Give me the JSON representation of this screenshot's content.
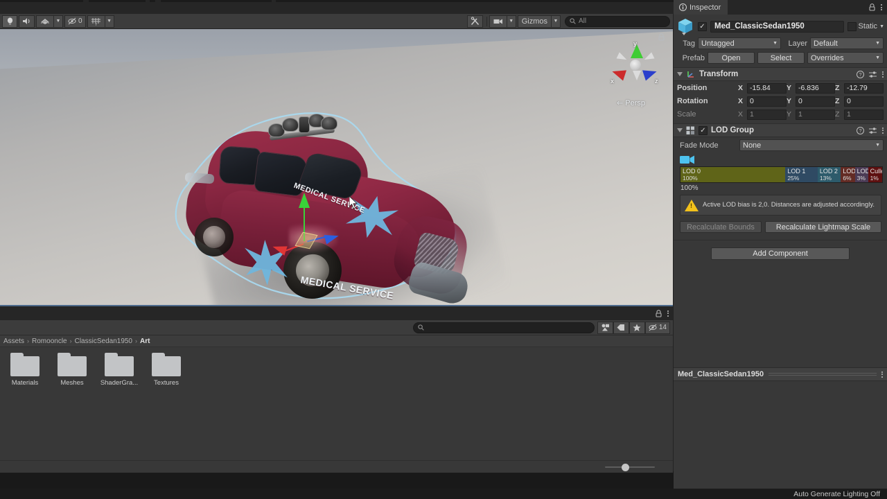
{
  "scene_toolbar": {
    "tools": [
      {
        "name": "lighting-toggle",
        "icon": "lightbulb-icon",
        "label": ""
      },
      {
        "name": "audio-toggle",
        "icon": "speaker-icon",
        "label": ""
      },
      {
        "name": "fx-toggle",
        "icon": "fx-icon",
        "label": ""
      },
      {
        "name": "hidden-objects",
        "icon": "eye-off-icon",
        "label": "0"
      },
      {
        "name": "grid-toggle",
        "icon": "grid-axis-icon",
        "label": ""
      }
    ],
    "tools_right": {
      "tools_icon": "wrench-screwdriver-icon",
      "camera_icon": "camera-icon",
      "gizmos_label": "Gizmos",
      "search_placeholder": "All",
      "search_value": "",
      "search_icon": "search-icon"
    }
  },
  "viewport": {
    "projection_label": "Persp",
    "projection_prefix": "⇐",
    "lock_icon": "lock-icon",
    "axis_labels": {
      "x": "x",
      "y": "y",
      "z": "z"
    },
    "axis_colors": {
      "x": "#cc2b2b",
      "y": "#3fcc34",
      "z": "#2b3fcc"
    },
    "model": {
      "body_color": "#8a2742",
      "decal_text_roof": "MEDICAL SERVICE",
      "decal_text_side": "MEDICAL SERVICE",
      "decal_star_color": "#6fb6dd",
      "selection_outline_color": "#a9d8ee"
    },
    "cursor_icon": "mouse-pointer-icon"
  },
  "project": {
    "tabbar": {
      "lock_icon": "lock-icon",
      "menu_icon": "kebab-menu-icon"
    },
    "toolbar": {
      "search_placeholder": "",
      "search_value": "",
      "search_icon": "search-icon",
      "filter_type_icon": "filter-type-icon",
      "filter_label_icon": "tag-icon",
      "favorites_icon": "star-icon",
      "hidden_icon": "eye-off-icon",
      "hidden_count": "14"
    },
    "breadcrumb": [
      "Assets",
      "Romooncle",
      "ClassicSedan1950",
      "Art"
    ],
    "breadcrumb_separator": "›",
    "assets": [
      {
        "label": "Materials",
        "icon": "folder-icon"
      },
      {
        "label": "Meshes",
        "icon": "folder-icon"
      },
      {
        "label": "ShaderGra...",
        "icon": "folder-icon"
      },
      {
        "label": "Textures",
        "icon": "folder-icon"
      }
    ],
    "zoom_slider_value": 33
  },
  "inspector": {
    "tab_label": "Inspector",
    "tab_icon": "info-circle-icon",
    "lock_icon": "lock-icon",
    "menu_icon": "kebab-menu-icon",
    "object": {
      "enabled": true,
      "enabled_check": "✓",
      "icon": "prefab-cube-icon",
      "name": "Med_ClassicSedan1950",
      "static_label": "Static",
      "static_checked": false,
      "tag_label": "Tag",
      "tag_value": "Untagged",
      "layer_label": "Layer",
      "layer_value": "Default",
      "prefab_label": "Prefab",
      "prefab_buttons": [
        "Open",
        "Select"
      ],
      "overrides_label": "Overrides"
    },
    "transform": {
      "title": "Transform",
      "icon": "transform-axis-icon",
      "help_icon": "help-circle-icon",
      "preset_icon": "preset-sliders-icon",
      "menu_icon": "kebab-menu-icon",
      "rows": [
        {
          "label": "Position",
          "dim": false,
          "values": [
            {
              "axis": "X",
              "value": "-15.84"
            },
            {
              "axis": "Y",
              "value": "-6.836"
            },
            {
              "axis": "Z",
              "value": "-12.79"
            }
          ]
        },
        {
          "label": "Rotation",
          "dim": false,
          "values": [
            {
              "axis": "X",
              "value": "0"
            },
            {
              "axis": "Y",
              "value": "0"
            },
            {
              "axis": "Z",
              "value": "0"
            }
          ]
        },
        {
          "label": "Scale",
          "dim": true,
          "values": [
            {
              "axis": "X",
              "value": "1"
            },
            {
              "axis": "Y",
              "value": "1"
            },
            {
              "axis": "Z",
              "value": "1"
            }
          ]
        }
      ]
    },
    "lod_group": {
      "title": "LOD Group",
      "icon": "lodgroup-icon",
      "enabled": true,
      "enabled_check": "✓",
      "help_icon": "help-circle-icon",
      "preset_icon": "preset-sliders-icon",
      "menu_icon": "kebab-menu-icon",
      "fade_mode_label": "Fade Mode",
      "fade_mode_value": "None",
      "camera_icon": "lod-camera-icon",
      "camera_icon_color": "#4ec3ef",
      "levels": [
        {
          "name": "LOD 0",
          "percent": "100%",
          "width_pct": 52.0,
          "color": "#5f6418"
        },
        {
          "name": "LOD 1",
          "percent": "25%",
          "width_pct": 16.0,
          "color": "#2f4a63"
        },
        {
          "name": "LOD 2",
          "percent": "13%",
          "width_pct": 11.5,
          "color": "#2d5b6b"
        },
        {
          "name": "LOD",
          "percent": "6%",
          "width_pct": 7.0,
          "color": "#632b24"
        },
        {
          "name": "LOD",
          "percent": "3%",
          "width_pct": 6.5,
          "color": "#4b3b55"
        },
        {
          "name": "Culled",
          "percent": "1%",
          "width_pct": 7.0,
          "color": "#5e1010"
        }
      ],
      "current_pct_label": "100%",
      "warning_icon": "warning-triangle-icon",
      "warning_text": "Active LOD bias is 2,0. Distances are adjusted accordingly.",
      "buttons": [
        {
          "label": "Recalculate Bounds",
          "disabled": true
        },
        {
          "label": "Recalculate Lightmap Scale",
          "disabled": false
        }
      ]
    },
    "add_component_label": "Add Component",
    "material_preview": {
      "name": "Med_ClassicSedan1950",
      "menu_icon": "kebab-menu-icon"
    }
  },
  "statusbar": {
    "text": "Auto Generate Lighting Off"
  }
}
